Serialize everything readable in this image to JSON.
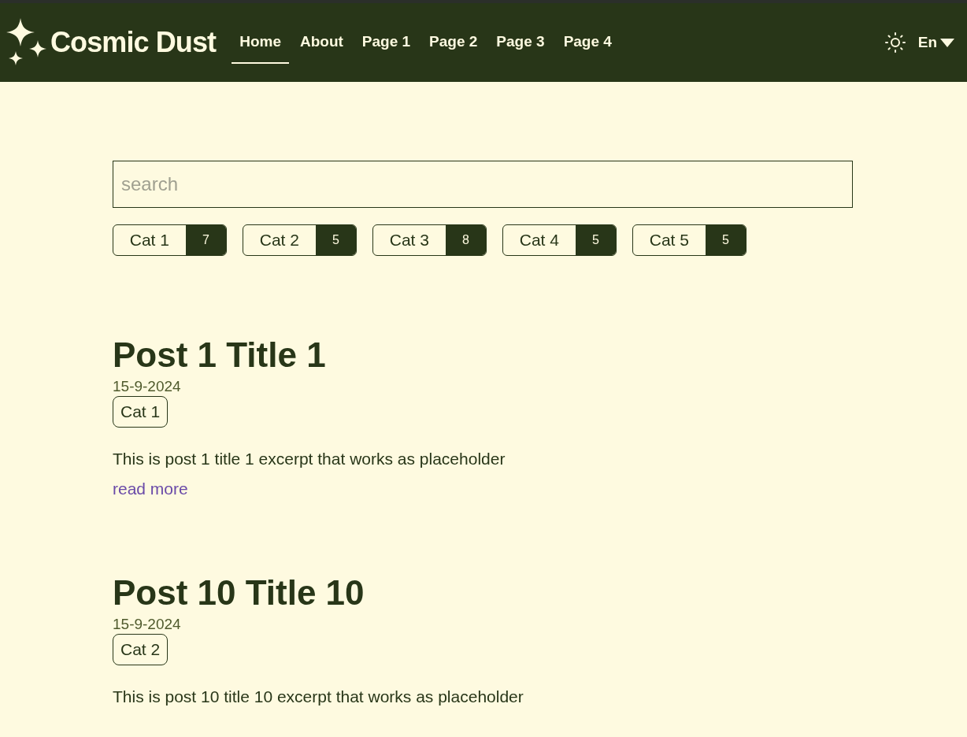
{
  "header": {
    "site_title": "Cosmic Dust",
    "nav": [
      {
        "label": "Home",
        "selected": true
      },
      {
        "label": "About",
        "selected": false
      },
      {
        "label": "Page 1",
        "selected": false
      },
      {
        "label": "Page 2",
        "selected": false
      },
      {
        "label": "Page 3",
        "selected": false
      },
      {
        "label": "Page 4",
        "selected": false
      }
    ],
    "language": "En"
  },
  "search": {
    "placeholder": "search"
  },
  "categories": [
    {
      "label": "Cat 1",
      "count": "7"
    },
    {
      "label": "Cat 2",
      "count": "5"
    },
    {
      "label": "Cat 3",
      "count": "8"
    },
    {
      "label": "Cat 4",
      "count": "5"
    },
    {
      "label": "Cat 5",
      "count": "5"
    }
  ],
  "posts": [
    {
      "title": "Post 1 Title 1",
      "date": "15-9-2024",
      "category": "Cat 1",
      "excerpt": "This is post 1 title 1 excerpt that works as placeholder",
      "link": "read more"
    },
    {
      "title": "Post 10 Title 10",
      "date": "15-9-2024",
      "category": "Cat 2",
      "excerpt": "This is post 10 title 10 excerpt that works as placeholder"
    }
  ]
}
